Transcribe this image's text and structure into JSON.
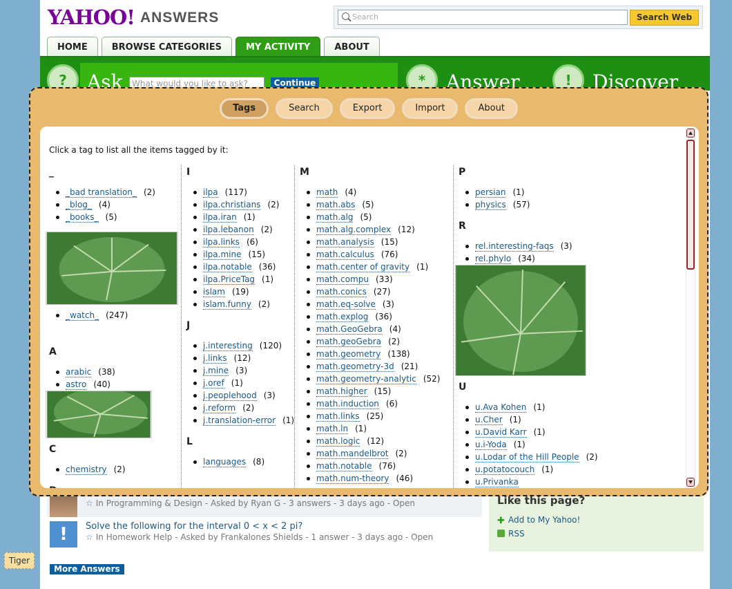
{
  "header": {
    "logo_yahoo": "YAHOO!",
    "logo_answers": "ANSWERS",
    "search_placeholder": "Search",
    "search_button": "Search Web"
  },
  "nav_tabs": [
    {
      "label": "HOME"
    },
    {
      "label": "BROWSE CATEGORIES"
    },
    {
      "label": "MY ACTIVITY",
      "active": true
    },
    {
      "label": "ABOUT"
    }
  ],
  "banner": {
    "ask": "Ask",
    "ask_placeholder": "What would you like to ask?",
    "continue": "Continue",
    "answer": "Answer",
    "discover": "Discover"
  },
  "questions": [
    {
      "title": "",
      "meta": "In Programming & Design - Asked by Ryan G - 3 answers - 3 days ago - Open"
    },
    {
      "title": "Solve the following for the interval 0 < x < 2 pi?",
      "meta": "In Homework Help - Asked by Frankalones Shields - 1 answer - 3 days ago - Open"
    }
  ],
  "sidebar": {
    "title": "Like this page?",
    "add_link": "Add to My Yahoo!",
    "rss_link": "RSS"
  },
  "more_answers": "More Answers",
  "tiger_label": "Tiger",
  "panel": {
    "buttons": [
      "Tags",
      "Search",
      "Export",
      "Import",
      "About"
    ],
    "intro": "Click a tag to list all the items tagged by it:",
    "col1": {
      "h_underscore": "_",
      "underscore_items": [
        {
          "tag": "_bad translation_",
          "count": "(2)"
        },
        {
          "tag": "_blog_",
          "count": "(4)"
        },
        {
          "tag": "_books_",
          "count": "(5)"
        }
      ],
      "watch_item": {
        "tag": "_watch_",
        "count": "(247)"
      },
      "h_a": "A",
      "a_items": [
        {
          "tag": "arabic",
          "count": "(38)"
        },
        {
          "tag": "astro",
          "count": "(40)"
        }
      ],
      "h_c": "C",
      "c_items": [
        {
          "tag": "chemistry",
          "count": "(2)"
        }
      ],
      "h_d": "D"
    },
    "col2": {
      "h_i": "I",
      "i_items": [
        {
          "tag": "ilpa",
          "count": "(117)"
        },
        {
          "tag": "ilpa.christians",
          "count": "(2)"
        },
        {
          "tag": "ilpa.iran",
          "count": "(1)"
        },
        {
          "tag": "ilpa.lebanon",
          "count": "(2)"
        },
        {
          "tag": "ilpa.links",
          "count": "(6)"
        },
        {
          "tag": "ilpa.mine",
          "count": "(15)"
        },
        {
          "tag": "ilpa.notable",
          "count": "(36)"
        },
        {
          "tag": "ilpa.PriceTag",
          "count": "(1)"
        },
        {
          "tag": "islam",
          "count": "(19)"
        },
        {
          "tag": "islam.funny",
          "count": "(2)"
        }
      ],
      "h_j": "J",
      "j_items": [
        {
          "tag": "j.interesting",
          "count": "(120)"
        },
        {
          "tag": "j.links",
          "count": "(12)"
        },
        {
          "tag": "j.mine",
          "count": "(3)"
        },
        {
          "tag": "j.oref",
          "count": "(1)"
        },
        {
          "tag": "j.peoplehood",
          "count": "(3)"
        },
        {
          "tag": "j.reform",
          "count": "(2)"
        },
        {
          "tag": "j.translation-error",
          "count": "(1)"
        }
      ],
      "h_l": "L",
      "l_items": [
        {
          "tag": "languages",
          "count": "(8)"
        }
      ]
    },
    "col3": {
      "h_m": "M",
      "m_items": [
        {
          "tag": "math",
          "count": "(4)"
        },
        {
          "tag": "math.abs",
          "count": "(5)"
        },
        {
          "tag": "math.alg",
          "count": "(5)"
        },
        {
          "tag": "math.alg.complex",
          "count": "(12)"
        },
        {
          "tag": "math.analysis",
          "count": "(15)"
        },
        {
          "tag": "math.calculus",
          "count": "(76)"
        },
        {
          "tag": "math.center of gravity",
          "count": "(1)"
        },
        {
          "tag": "math.compu",
          "count": "(33)"
        },
        {
          "tag": "math.conics",
          "count": "(27)"
        },
        {
          "tag": "math.eq-solve",
          "count": "(3)"
        },
        {
          "tag": "math.explog",
          "count": "(36)"
        },
        {
          "tag": "math.GeoGebra",
          "count": "(4)"
        },
        {
          "tag": "math.geoGebra",
          "count": "(2)"
        },
        {
          "tag": "math.geometry",
          "count": "(138)"
        },
        {
          "tag": "math.geometry-3d",
          "count": "(21)"
        },
        {
          "tag": "math.geometry-analytic",
          "count": "(52)"
        },
        {
          "tag": "math.higher",
          "count": "(15)"
        },
        {
          "tag": "math.induction",
          "count": "(6)"
        },
        {
          "tag": "math.links",
          "count": "(25)"
        },
        {
          "tag": "math.ln",
          "count": "(1)"
        },
        {
          "tag": "math.logic",
          "count": "(12)"
        },
        {
          "tag": "math.mandelbrot",
          "count": "(2)"
        },
        {
          "tag": "math.notable",
          "count": "(76)"
        },
        {
          "tag": "math.num-theory",
          "count": "(46)"
        }
      ]
    },
    "col4": {
      "h_p": "P",
      "p_items": [
        {
          "tag": "persian",
          "count": "(1)"
        },
        {
          "tag": "physics",
          "count": "(57)"
        }
      ],
      "h_r": "R",
      "r_items": [
        {
          "tag": "rel.interesting-faqs",
          "count": "(3)"
        },
        {
          "tag": "rel.phylo",
          "count": "(34)"
        }
      ],
      "h_u": "U",
      "u_items": [
        {
          "tag": "u.Ava Kohen",
          "count": "(1)"
        },
        {
          "tag": "u.Cher",
          "count": "(1)"
        },
        {
          "tag": "u.David Karr",
          "count": "(1)"
        },
        {
          "tag": "u.i-Yoda",
          "count": "(1)"
        },
        {
          "tag": "u.Lodar of the Hill People",
          "count": "(2)"
        },
        {
          "tag": "u.potatocouch",
          "count": "(1)"
        },
        {
          "tag": "u.Privanka",
          "count": ""
        }
      ]
    }
  },
  "colors": {
    "accent_green": "#1f8f14",
    "panel_tan": "#e9b96e",
    "link_blue": "#19598c",
    "yahoo_purple": "#7b0099"
  }
}
